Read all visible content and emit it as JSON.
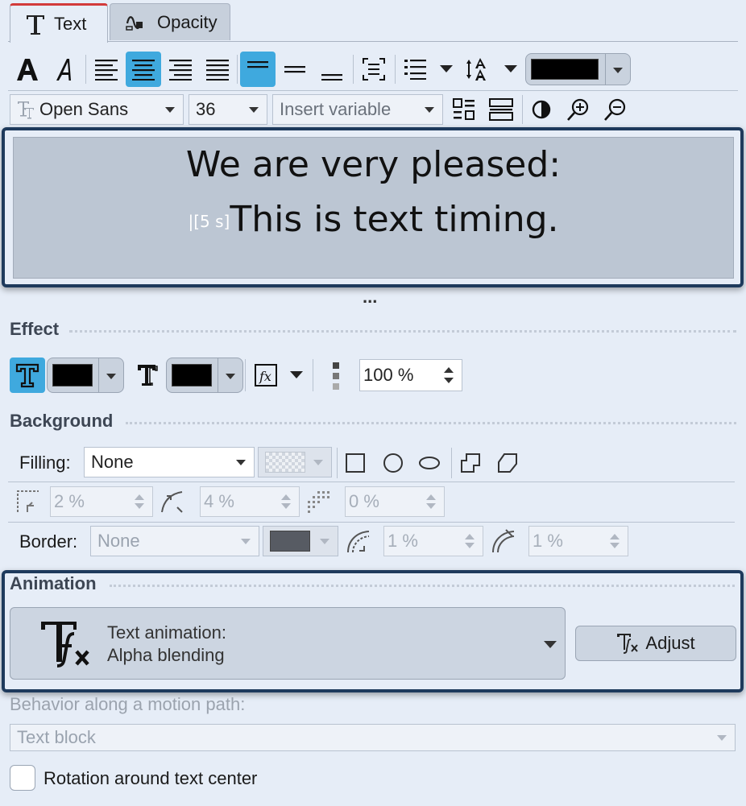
{
  "tabs": [
    {
      "label": "Text",
      "active": true
    },
    {
      "label": "Opacity",
      "active": false
    }
  ],
  "toolbar": {
    "color_swatch": "#000000",
    "accent": "#3fa9de"
  },
  "font_row": {
    "font_family": "Open Sans",
    "font_size": "36",
    "variable_placeholder": "Insert variable"
  },
  "preview": {
    "line1": "We are very pleased:",
    "timing_marker": "|[5 s]",
    "line2": "This is text timing.",
    "more": "..."
  },
  "effect": {
    "title": "Effect",
    "opacity_value": "100 %"
  },
  "background": {
    "title": "Background",
    "filling_label": "Filling:",
    "filling_value": "None",
    "corner_value": "2 %",
    "radius_value": "4 %",
    "shadow_value": "0 %",
    "border_label": "Border:",
    "border_value": "None",
    "border_width_1": "1 %",
    "border_width_2": "1 %"
  },
  "animation": {
    "title": "Animation",
    "label": "Text animation:",
    "value": "Alpha blending",
    "adjust_label": "Adjust"
  },
  "motion": {
    "label": "Behavior along a motion path:",
    "value": "Text block"
  },
  "rotation": {
    "label": "Rotation around text center",
    "checked": false
  }
}
